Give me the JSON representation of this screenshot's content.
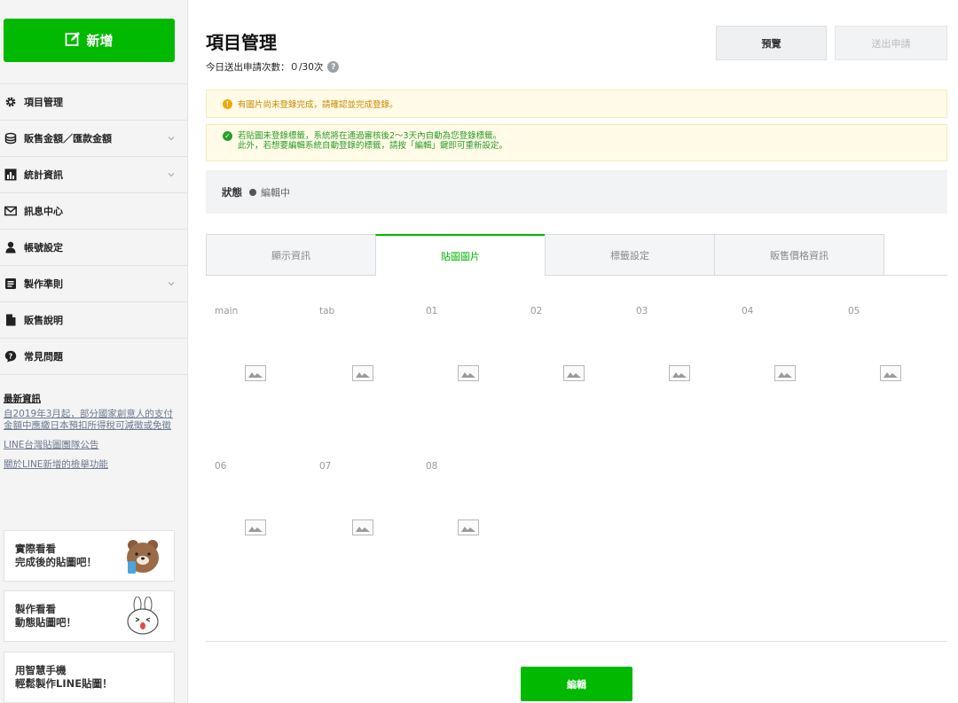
{
  "sidebar": {
    "new_button": "新增",
    "items": [
      {
        "label": "項目管理",
        "icon": "gear-icon",
        "has_chevron": false
      },
      {
        "label": "販售金額／匯款金額",
        "icon": "coins-icon",
        "has_chevron": true
      },
      {
        "label": "統計資訊",
        "icon": "bar-chart-icon",
        "has_chevron": true
      },
      {
        "label": "訊息中心",
        "icon": "mail-icon",
        "has_chevron": false
      },
      {
        "label": "帳號設定",
        "icon": "person-icon",
        "has_chevron": false
      },
      {
        "label": "製作準則",
        "icon": "document-icon",
        "has_chevron": true
      },
      {
        "label": "販售說明",
        "icon": "file-icon",
        "has_chevron": false
      },
      {
        "label": "常見問題",
        "icon": "question-bubble-icon",
        "has_chevron": false
      }
    ],
    "news": {
      "title": "最新資訊",
      "links": [
        "自2019年3月起，部分國家創意人的支付金額中應繳日本預扣所得稅可減徵或免徵",
        "LINE台灣貼圖團隊公告",
        "關於LINE新增的檢舉功能"
      ]
    },
    "promos": [
      {
        "line1": "實際看看",
        "line2": "完成後的貼圖吧！"
      },
      {
        "line1": "製作看看",
        "line2": "動態貼圖吧！"
      },
      {
        "line1": "用智慧手機",
        "line2": "輕鬆製作LINE貼圖！"
      }
    ]
  },
  "header": {
    "title": "項目管理",
    "quota": "今日送出申請次數：０/30次",
    "preview_button": "預覽",
    "submit_button": "送出申請"
  },
  "alerts": {
    "warning": "有圖片尚未登錄完成，請確認並完成登錄。",
    "info_line1": "若貼圖未登錄標籤，系統將在通過審核後2～3天內自動為您登錄標籤。",
    "info_line2": "此外，若想要編輯系統自動登錄的標籤，請按「編輯」鍵即可重新設定。"
  },
  "status": {
    "label": "狀態",
    "value": "編輯中"
  },
  "tabs": [
    "顯示資訊",
    "貼圖圖片",
    "標籤設定",
    "販售價格資訊"
  ],
  "active_tab": 1,
  "image_slots": {
    "row1": [
      "main",
      "tab",
      "01",
      "02",
      "03",
      "04",
      "05"
    ],
    "row2": [
      "06",
      "07",
      "08"
    ]
  },
  "edit_button": "編輯",
  "colors": {
    "brand_green": "#00b900",
    "warning_text": "#c78900",
    "success_text": "#2a9d2a"
  }
}
